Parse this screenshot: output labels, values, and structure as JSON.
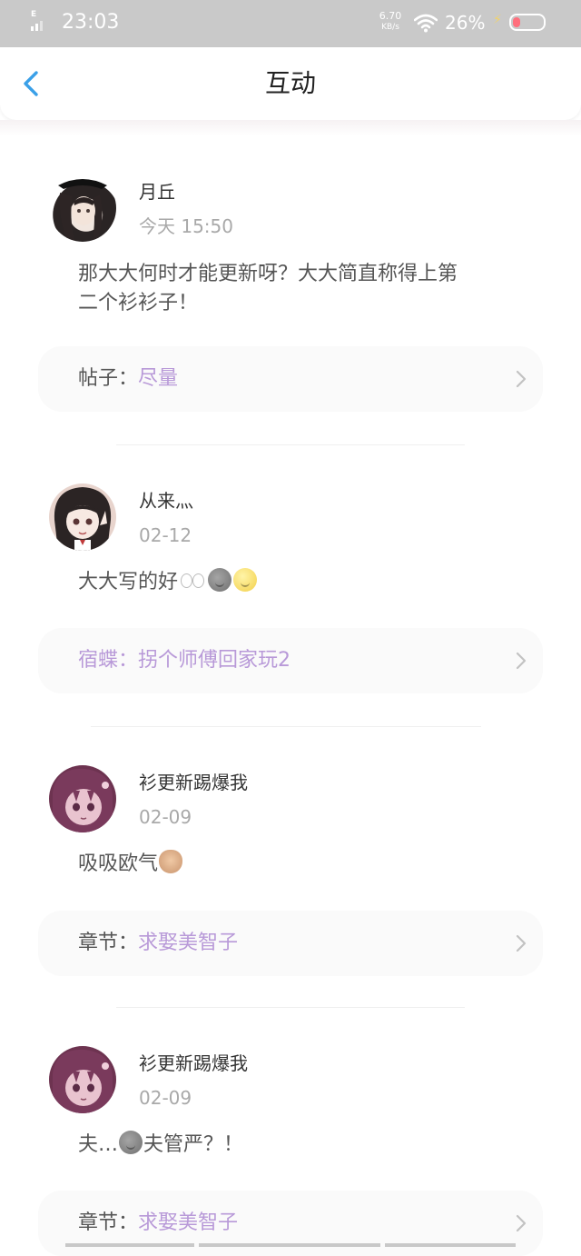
{
  "status_bar": {
    "network": "E",
    "time": "23:03",
    "speed_value": "6.70",
    "speed_unit": "KB/s",
    "battery_percent": "26%",
    "battery_level": 0.26
  },
  "nav": {
    "title": "互动"
  },
  "items": [
    {
      "username": "月丘",
      "time": "今天 15:50",
      "comment_line1": "那大大何时才能更新呀？大大简直称得上第",
      "comment_line2": "二个衫衫子！",
      "source_label": "帖子：",
      "source_title": "尽量"
    },
    {
      "username": "从来灬",
      "time": "02-12",
      "comment": "大大写的好",
      "source_label": "宿蝶：",
      "source_title": "拐个师傅回家玩2"
    },
    {
      "username": "衫更新踢爆我",
      "time": "02-09",
      "comment": "吸吸欧气",
      "source_label": "章节：",
      "source_title": "求娶美智子"
    },
    {
      "username": "衫更新踢爆我",
      "time": "02-09",
      "comment_part1": "夫…",
      "comment_part2": "夫管严？！",
      "source_label": "章节：",
      "source_title": "求娶美智子"
    }
  ],
  "colors": {
    "accent_blue": "#3aa0e8",
    "link_purple": "#b899d8",
    "status_bar_bg": "#c9c9c9"
  },
  "icons": [
    "back-arrow-icon",
    "chevron-right-icon",
    "wifi-icon",
    "battery-icon",
    "signal-icon"
  ]
}
